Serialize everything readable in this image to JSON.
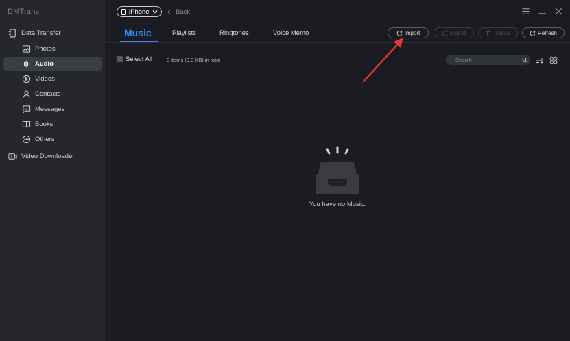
{
  "app": {
    "title": "DMTrans"
  },
  "sidebar": {
    "items": [
      {
        "label": "Data Transfer",
        "icon": "data-transfer-icon"
      },
      {
        "label": "Photos",
        "icon": "photos-icon"
      },
      {
        "label": "Audio",
        "icon": "audio-icon",
        "active": true
      },
      {
        "label": "Videos",
        "icon": "videos-icon"
      },
      {
        "label": "Contacts",
        "icon": "contacts-icon"
      },
      {
        "label": "Messages",
        "icon": "messages-icon"
      },
      {
        "label": "Books",
        "icon": "books-icon"
      },
      {
        "label": "Others",
        "icon": "others-icon"
      },
      {
        "label": "Video Downloader",
        "icon": "video-downloader-icon"
      }
    ]
  },
  "topbar": {
    "device": "iPhone",
    "back_label": "Back"
  },
  "tabs": [
    {
      "label": "Music",
      "active": true
    },
    {
      "label": "Playlists"
    },
    {
      "label": "Ringtones"
    },
    {
      "label": "Voice Memo"
    }
  ],
  "actions": {
    "import_label": "Import",
    "export_label": "Export",
    "delete_label": "Delete",
    "refresh_label": "Refresh"
  },
  "toolbar": {
    "select_all_label": "Select All",
    "count_text": "0 items (0.0 KB) in total",
    "search_placeholder": "Search"
  },
  "empty_state": {
    "message": "You have no Music."
  },
  "colors": {
    "accent": "#2f8cf5",
    "sidebar_bg": "#26272d",
    "main_bg": "#1b1c21",
    "annotation_arrow": "#e8372c"
  }
}
